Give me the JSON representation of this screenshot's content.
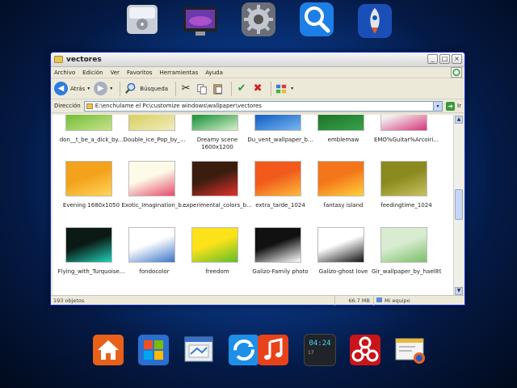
{
  "window": {
    "title": "vectores",
    "menu": [
      "Archivo",
      "Edición",
      "Ver",
      "Favoritos",
      "Herramientas",
      "Ayuda"
    ],
    "toolbar": {
      "back_label": "Atrás",
      "search_label": "Búsqueda"
    },
    "address": {
      "label": "Dirección",
      "value": "E:\\enchulame el Pc\\customize windows\\wallpaper\\vectores",
      "go_label": "Ir"
    },
    "files": [
      {
        "name": "don__t_be_a_dick_by...",
        "colors": [
          "#7cc242",
          "#c8e38a"
        ]
      },
      {
        "name": "Double_Ice_Pop_by_...",
        "colors": [
          "#d9d36a",
          "#f2ecc0"
        ]
      },
      {
        "name": "Dreamy scene",
        "sub": "1600x1200",
        "colors": [
          "#2a9a4a",
          "#d9efc9"
        ]
      },
      {
        "name": "Du_vent_wallpaper_b...",
        "colors": [
          "#1e67c8",
          "#78b7f0"
        ]
      },
      {
        "name": "emblemaw",
        "colors": [
          "#1f7a2c",
          "#3aa14a"
        ]
      },
      {
        "name": "EMO%Guitar%Arcoiri...",
        "colors": [
          "#f2f2f2",
          "#d6357a"
        ]
      },
      {
        "name": "Evening 1680x1050",
        "colors": [
          "#f3a21b",
          "#ffd55a"
        ]
      },
      {
        "name": "Exotic_Imagination_b...",
        "colors": [
          "#fdfbe8",
          "#e64a6a"
        ]
      },
      {
        "name": "experimental_colors_b...",
        "colors": [
          "#3b1d10",
          "#e2312a"
        ]
      },
      {
        "name": "extra_tarde_1024",
        "colors": [
          "#f15a1a",
          "#fcbb3b"
        ]
      },
      {
        "name": "fantasy island",
        "colors": [
          "#f4761a",
          "#ffd13a"
        ]
      },
      {
        "name": "feedingtime_1024",
        "colors": [
          "#8a8a1e",
          "#c8c260"
        ]
      },
      {
        "name": "Flying_with_Turquoise...",
        "colors": [
          "#0b1a14",
          "#1fd0b8"
        ]
      },
      {
        "name": "fondocolor",
        "colors": [
          "#ffffff",
          "#3b74c8"
        ]
      },
      {
        "name": "freedom",
        "colors": [
          "#fde21a",
          "#5fbf2a"
        ]
      },
      {
        "name": "Galizo-Family photo",
        "colors": [
          "#111111",
          "#ffffff"
        ]
      },
      {
        "name": "Galizo-ghost love",
        "colors": [
          "#ffffff",
          "#111111"
        ]
      },
      {
        "name": "Gir_wallpaper_by_hael89",
        "colors": [
          "#d8ecd0",
          "#7cbf6a"
        ]
      }
    ],
    "status": {
      "count": "193 objetos",
      "size": "66.7 MB",
      "location": "Mi equipo"
    }
  },
  "dock_top": [
    "hard-drive-icon",
    "monitor-icon",
    "settings-gear-icon",
    "magnifier-search-icon",
    "rocket-launch-icon"
  ],
  "dock_bottom": [
    "home-icon",
    "windows-logo-icon",
    "file-window-icon",
    "refresh-sync-icon",
    "music-note-icon",
    "clock-widget-icon",
    "biohazard-icon",
    "browser-firefox-icon"
  ],
  "clock": {
    "time": "04:24",
    "day": "17"
  }
}
